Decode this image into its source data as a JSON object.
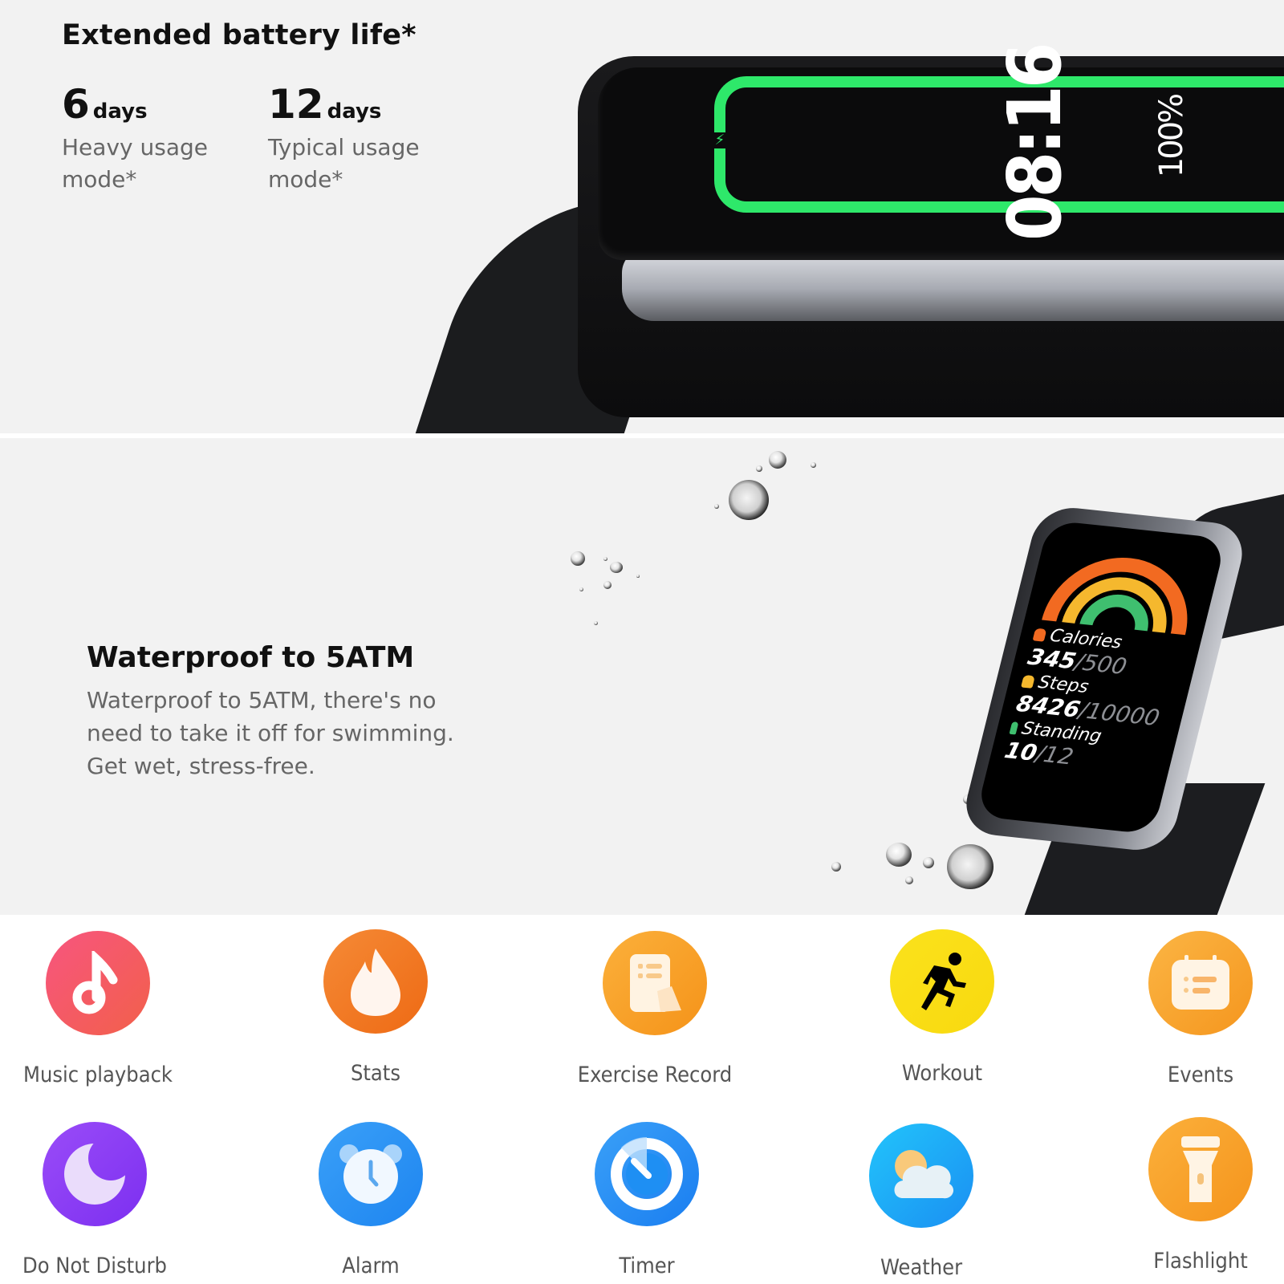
{
  "battery": {
    "title": "Extended battery life*",
    "modes": [
      {
        "value": "6",
        "unit": "days",
        "desc": "Heavy usage mode*"
      },
      {
        "value": "12",
        "unit": "days",
        "desc": "Typical usage mode*"
      }
    ],
    "watch_screen": {
      "time": "08:16",
      "charge": "100%",
      "ring_color": "#2ee86a",
      "charging_icon": "charging-bolt-icon"
    }
  },
  "waterproof": {
    "title": "Waterproof to 5ATM",
    "description": "Waterproof to 5ATM, there's no need to take it off for swimming. Get wet, stress-free.",
    "watch_screen": {
      "stats": [
        {
          "label": "Calories",
          "value": "345",
          "goal": "/500",
          "color": "#f26a21",
          "icon": "flame-icon"
        },
        {
          "label": "Steps",
          "value": "8426",
          "goal": "/10000",
          "color": "#f5b82e",
          "icon": "shoe-icon"
        },
        {
          "label": "Standing",
          "value": "10",
          "goal": "/12",
          "color": "#3fbf6f",
          "icon": "standing-person-icon"
        }
      ]
    }
  },
  "features": [
    {
      "label": "Music playback",
      "icon": "music-note-icon",
      "color_a": "#f7557f",
      "color_b": "#f2604a"
    },
    {
      "label": "Stats",
      "icon": "flame-icon",
      "color_a": "#f58a36",
      "color_b": "#ee6a14"
    },
    {
      "label": "Exercise Record",
      "icon": "clipboard-record-icon",
      "color_a": "#fbb03b",
      "color_b": "#f59319"
    },
    {
      "label": "Workout",
      "icon": "running-person-icon",
      "color_a": "#fbe21c",
      "color_b": "#f8d90f"
    },
    {
      "label": "Events",
      "icon": "calendar-icon",
      "color_a": "#fbb544",
      "color_b": "#f5961e"
    },
    {
      "label": "Do Not Disturb",
      "icon": "moon-icon",
      "color_a": "#9a4cf8",
      "color_b": "#7c2ff0"
    },
    {
      "label": "Alarm",
      "icon": "alarm-clock-icon",
      "color_a": "#3aa0f8",
      "color_b": "#1e85f0"
    },
    {
      "label": "Timer",
      "icon": "timer-icon",
      "color_a": "#3aa0f8",
      "color_b": "#1a7ef0"
    },
    {
      "label": "Weather",
      "icon": "cloud-sun-icon",
      "color_a": "#22c4fb",
      "color_b": "#1a8ff2"
    },
    {
      "label": "Flashlight",
      "icon": "flashlight-icon",
      "color_a": "#fbb03b",
      "color_b": "#f5941c"
    }
  ]
}
